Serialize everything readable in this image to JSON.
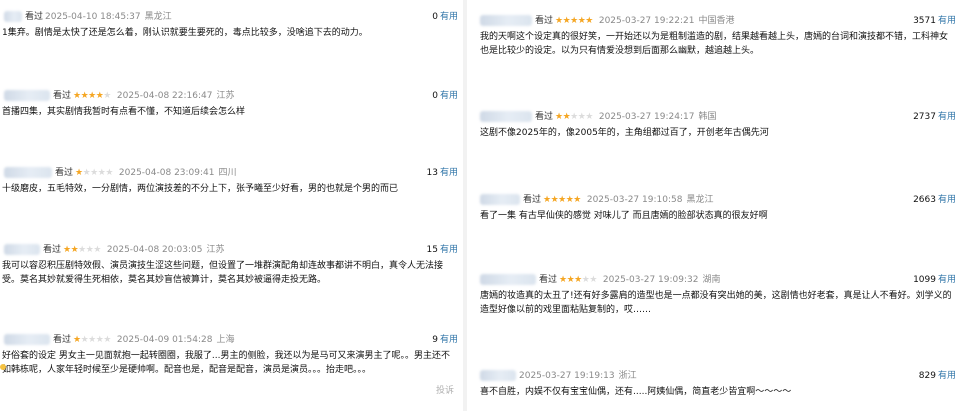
{
  "labels": {
    "watched": "看过",
    "useful": "有用",
    "report": "投诉"
  },
  "left_reviews": [
    {
      "time": "2025-04-10 18:45:37",
      "location": "黑龙江",
      "stars": 0,
      "votes": "0",
      "content": "1集弃。剧情是太快了还是怎么着，刚认识就要生要死的，毒点比较多，没啥追下去的动力。"
    },
    {
      "time": "2025-04-08 22:16:47",
      "location": "江苏",
      "stars": 4,
      "votes": "0",
      "content": "首播四集，其实剧情我暂时有点看不懂，不知道后续会怎么样"
    },
    {
      "time": "2025-04-08 23:09:41",
      "location": "四川",
      "stars": 1,
      "votes": "13",
      "content": "十级磨皮，五毛特效，一分剧情，两位演技差的不分上下，张予曦至少好看，男的也就是个男的而已"
    },
    {
      "time": "2025-04-08 20:03:05",
      "location": "江苏",
      "stars": 2,
      "votes": "15",
      "content": "我可以容忍积压剧特效假、演员演技生涩这些问题，但设置了一堆群演配角却连故事都讲不明白，真令人无法接受。莫名其妙就爱得生死相依，莫名其妙盲信被算计，莫名其妙被逼得走投无路。"
    },
    {
      "time": "2025-04-09 01:54:28",
      "location": "上海",
      "stars": 1,
      "votes": "9",
      "content": "好俗套的设定 男女主一见面就抱一起转圈圈，我服了...男主的侧脸，我还以为是马可又来演男主了呢。。男主还不如韩栋呢，人家年轻时候至少是硬帅啊。配音也是，配音是配音，演员是演员。。。抬走吧。。。"
    }
  ],
  "right_reviews": [
    {
      "time": "2025-03-27 19:22:21",
      "location": "中国香港",
      "stars": 5,
      "votes": "3571",
      "content": "我的天啊这个设定真的很好笑，一开始还以为是粗制滥造的剧，结果越看越上头，唐嫣的台词和演技都不错，工科神女也是比较少的设定。以为只有情爱没想到后面那么幽默，越追越上头。"
    },
    {
      "time": "2025-03-27 19:24:17",
      "location": "韩国",
      "stars": 2,
      "votes": "2737",
      "content": "这剧不像2025年的，像2005年的，主角组都过百了，开创老年古偶先河"
    },
    {
      "time": "2025-03-27 19:10:58",
      "location": "黑龙江",
      "stars": 5,
      "votes": "2663",
      "content": "看了一集 有古早仙侠的感觉 对味儿了 而且唐嫣的脸部状态真的很友好啊"
    },
    {
      "time": "2025-03-27 19:09:32",
      "location": "湖南",
      "stars": 3,
      "votes": "1099",
      "content": "唐嫣的妆造真的太丑了!还有好多露肩的造型也是一点都没有突出她的美，这剧情也好老套，真是让人不看好。刘学义的造型好像以前的戏里面粘贴复制的，哎……"
    },
    {
      "time": "2025-03-27 19:19:13",
      "location": "浙江",
      "stars": 0,
      "votes": "829",
      "content": "喜不自胜，内娱不仅有宝宝仙偶，还有.....阿姨仙偶，简直老少皆宜啊～～～～"
    }
  ]
}
